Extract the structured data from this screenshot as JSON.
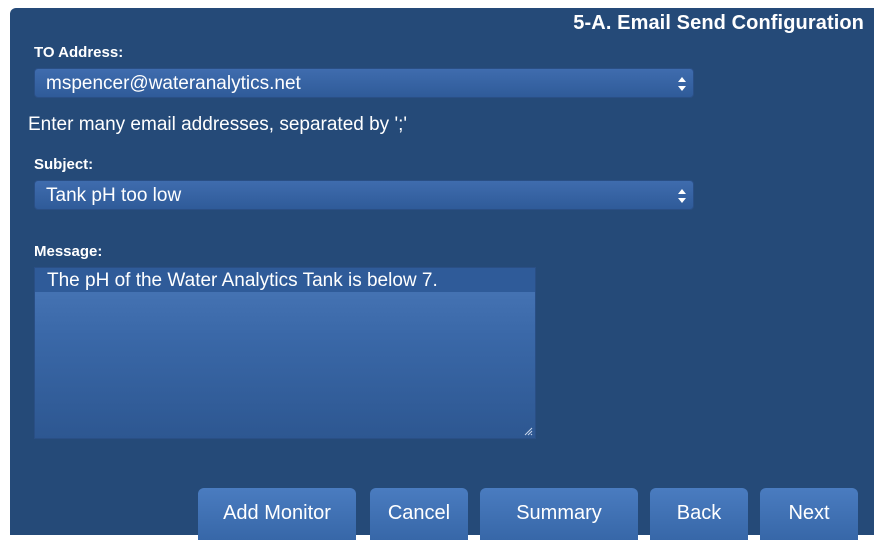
{
  "header": {
    "title": "5-A. Email Send Configuration"
  },
  "to_address": {
    "label": "TO Address:",
    "value": "mspencer@wateranalytics.net",
    "hint": "Enter many email addresses, separated by ';'"
  },
  "subject": {
    "label": "Subject:",
    "value": "Tank pH too low"
  },
  "message": {
    "label": "Message:",
    "value": "The pH of the Water Analytics Tank is below 7."
  },
  "buttons": {
    "add_monitor": "Add Monitor",
    "cancel": "Cancel",
    "summary": "Summary",
    "back": "Back",
    "next": "Next"
  },
  "icons": {
    "select_arrows": "up-down-chevron-icon",
    "resize": "resize-grip-icon"
  },
  "colors": {
    "panel": "#254a78",
    "control": "#3767a8",
    "text": "#ffffff"
  }
}
